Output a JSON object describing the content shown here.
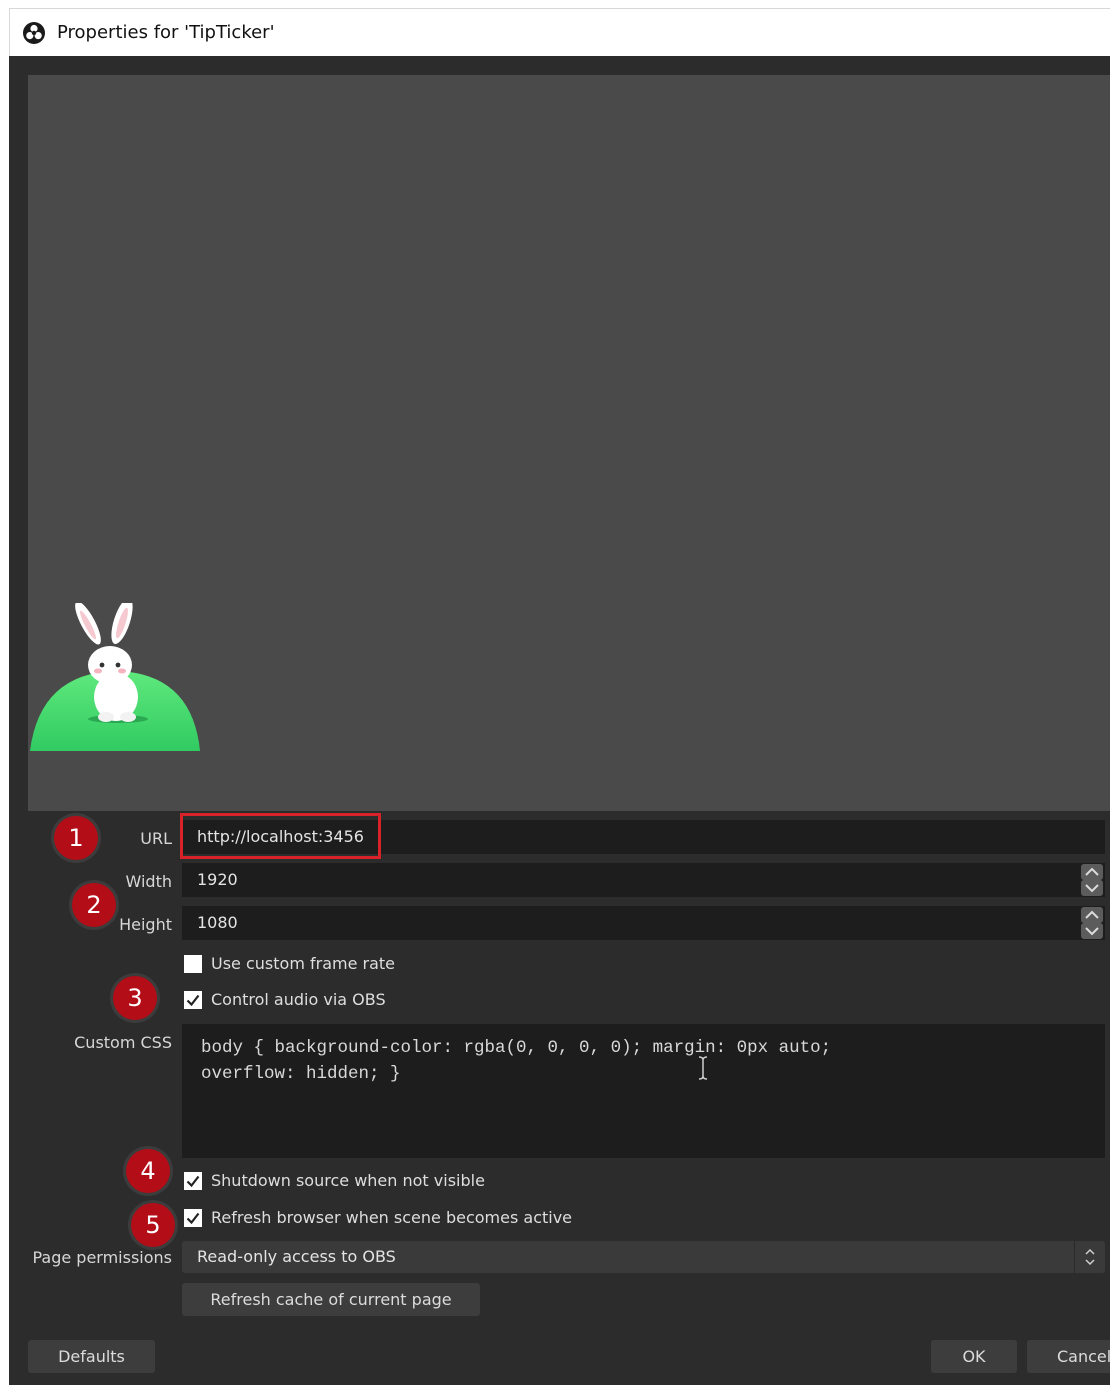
{
  "window": {
    "title": "Properties for 'TipTicker'",
    "icon": "obs-logo-icon"
  },
  "form": {
    "url": {
      "label": "URL",
      "value": "http://localhost:3456"
    },
    "width": {
      "label": "Width",
      "value": "1920"
    },
    "height": {
      "label": "Height",
      "value": "1080"
    },
    "custom_frame_rate": {
      "label": "Use custom frame rate",
      "checked": false
    },
    "control_audio": {
      "label": "Control audio via OBS",
      "checked": true
    },
    "custom_css": {
      "label": "Custom CSS",
      "value": "body { background-color: rgba(0, 0, 0, 0); margin: 0px auto;\noverflow: hidden; }"
    },
    "shutdown_source": {
      "label": "Shutdown source when not visible",
      "checked": true
    },
    "refresh_browser": {
      "label": "Refresh browser when scene becomes active",
      "checked": true
    },
    "page_permissions": {
      "label": "Page permissions",
      "value": "Read-only access to OBS"
    },
    "refresh_cache_label": "Refresh cache of current page"
  },
  "buttons": {
    "defaults": "Defaults",
    "ok": "OK",
    "cancel": "Cancel"
  },
  "markers": [
    "1",
    "2",
    "3",
    "4",
    "5"
  ],
  "colors": {
    "dialog_bg": "#2c2c2c",
    "preview_bg": "#4a4a4a",
    "field_bg": "#1d1d1d",
    "marker": "#b30d17",
    "highlight": "#d8222a"
  }
}
